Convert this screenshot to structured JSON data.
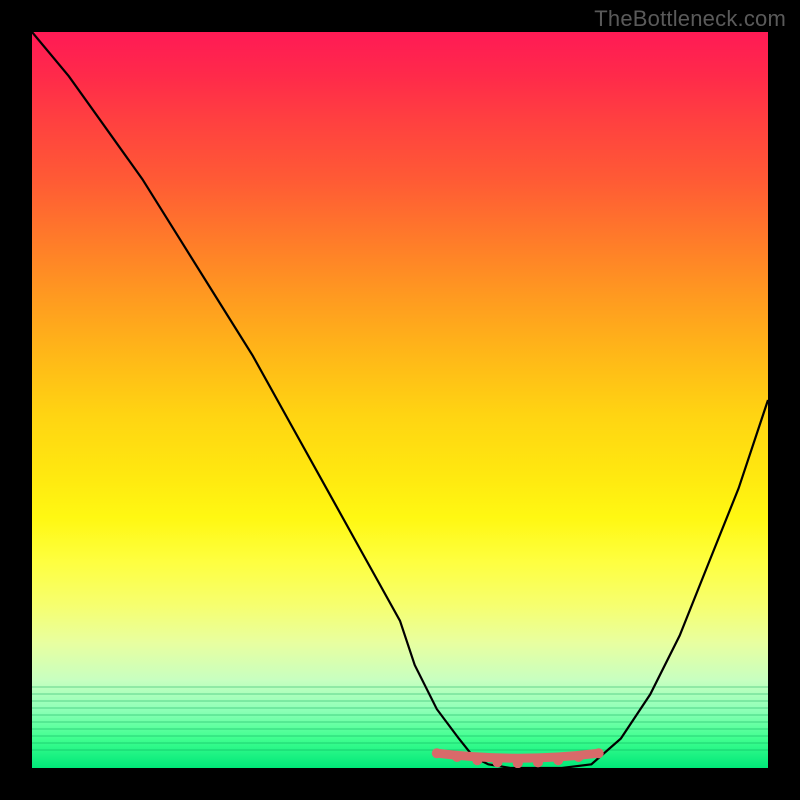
{
  "watermark": "TheBottleneck.com",
  "chart_data": {
    "type": "line",
    "title": "",
    "xlabel": "",
    "ylabel": "",
    "xlim": [
      0,
      100
    ],
    "ylim": [
      0,
      100
    ],
    "series": [
      {
        "name": "bottleneck-curve",
        "x": [
          0,
          5,
          10,
          15,
          20,
          25,
          30,
          35,
          40,
          45,
          50,
          52,
          55,
          58,
          60,
          62,
          65,
          68,
          72,
          76,
          80,
          84,
          88,
          92,
          96,
          100
        ],
        "values": [
          100,
          94,
          87,
          80,
          72,
          64,
          56,
          47,
          38,
          29,
          20,
          14,
          8,
          4,
          1.5,
          0.5,
          0,
          0,
          0,
          0.5,
          4,
          10,
          18,
          28,
          38,
          50
        ]
      }
    ],
    "annotations": [
      {
        "name": "optimal-band",
        "x_start": 55,
        "x_end": 77,
        "y": 1.2
      }
    ],
    "background": {
      "type": "vertical-gradient",
      "stops": [
        {
          "pos": 0.0,
          "color": "#ff1a55"
        },
        {
          "pos": 0.5,
          "color": "#ffd412"
        },
        {
          "pos": 0.78,
          "color": "#f6ff70"
        },
        {
          "pos": 1.0,
          "color": "#00e878"
        }
      ]
    }
  }
}
